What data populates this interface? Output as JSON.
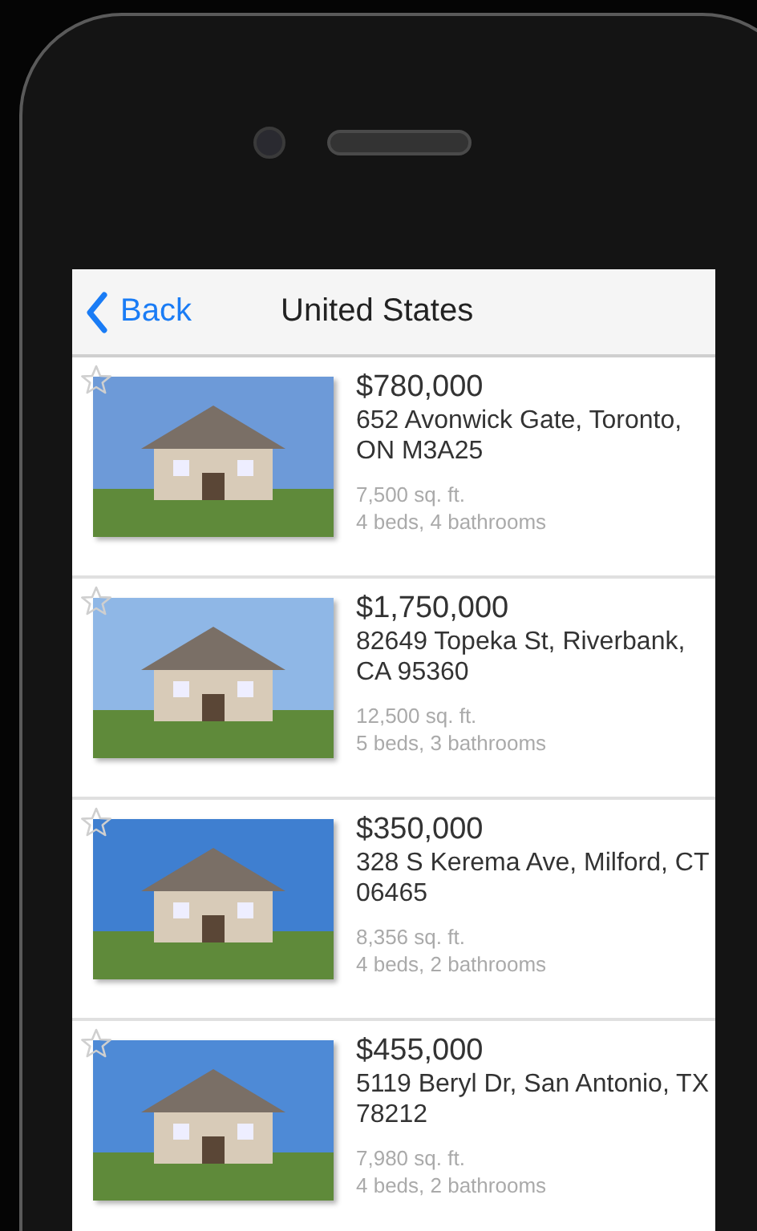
{
  "nav_bar": {
    "back_label": "Back",
    "title": "United States"
  },
  "listings": [
    {
      "favorite": false,
      "price": "$780,000",
      "address": "652 Avonwick Gate, Toronto, ON M3A25",
      "area": "7,500 sq. ft.",
      "rooms": "4 beds, 4 bathrooms"
    },
    {
      "favorite": false,
      "price": "$1,750,000",
      "address": "82649 Topeka St, Riverbank, CA 95360",
      "area": "12,500 sq. ft.",
      "rooms": "5 beds, 3 bathrooms"
    },
    {
      "favorite": false,
      "price": "$350,000",
      "address": "328 S Kerema Ave, Milford, CT 06465",
      "area": "8,356 sq. ft.",
      "rooms": "4 beds, 2 bathrooms"
    },
    {
      "favorite": false,
      "price": "$455,000",
      "address": "5119 Beryl Dr, San Antonio, TX 78212",
      "area": "7,980 sq. ft.",
      "rooms": "4 beds, 2 bathrooms"
    }
  ]
}
